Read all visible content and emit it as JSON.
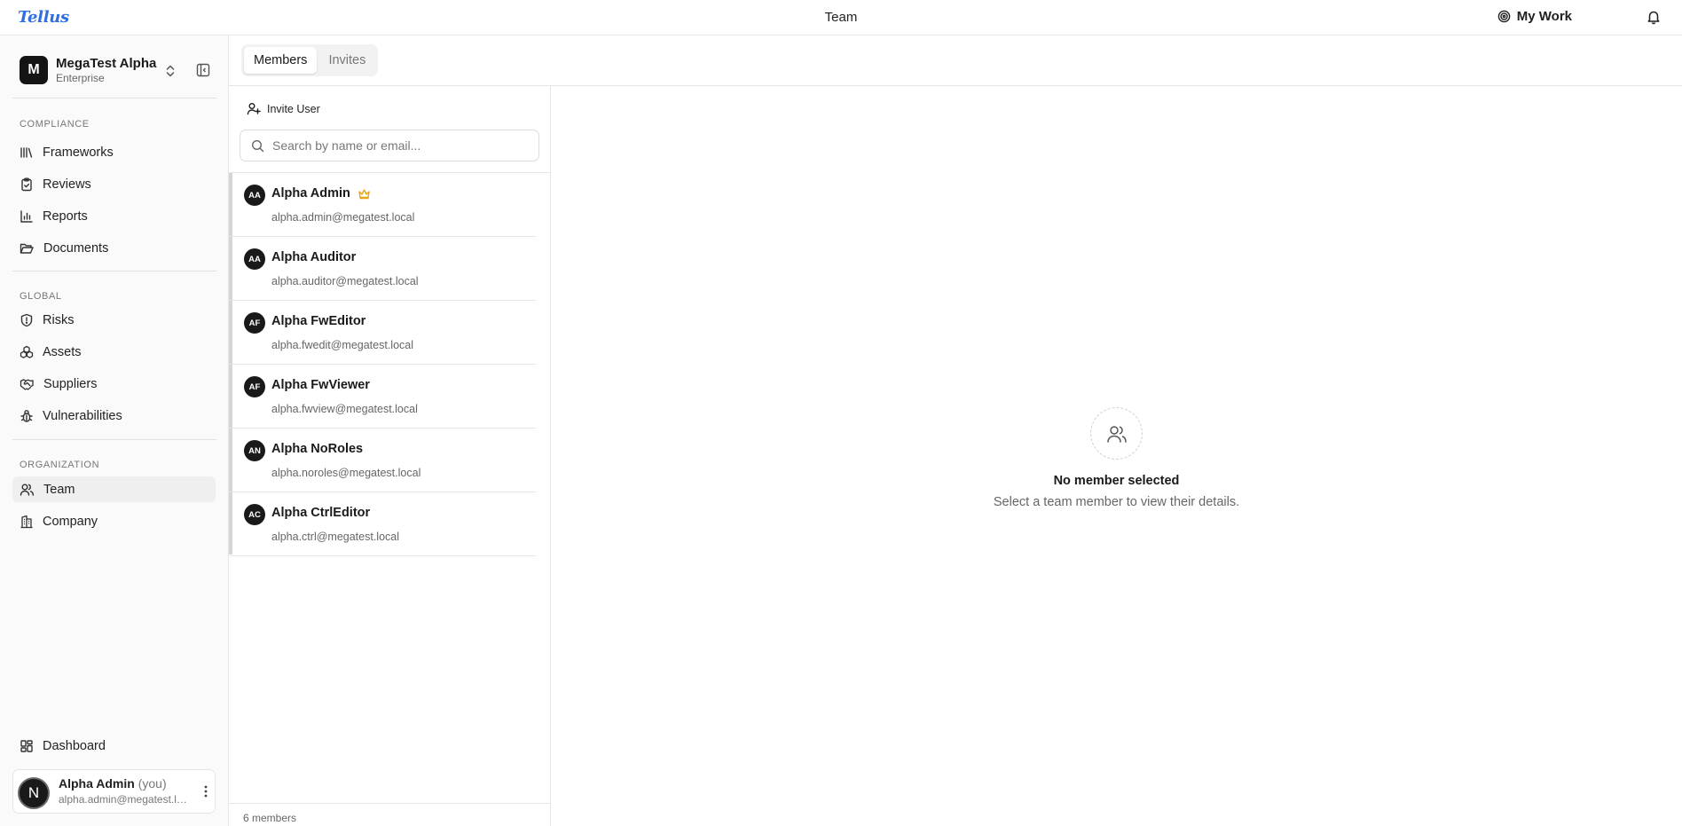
{
  "app": {
    "logo": "Tellus",
    "page_title": "Team"
  },
  "topbar": {
    "my_work_label": "My Work"
  },
  "org": {
    "avatar_letter": "M",
    "name": "MegaTest Alpha",
    "plan": "Enterprise"
  },
  "sidebar": {
    "sections": [
      {
        "label": "Compliance",
        "items": [
          "Frameworks",
          "Reviews",
          "Reports",
          "Documents"
        ]
      },
      {
        "label": "Global",
        "items": [
          "Risks",
          "Assets",
          "Suppliers",
          "Vulnerabilities"
        ]
      },
      {
        "label": "Organization",
        "items": [
          "Team",
          "Company"
        ]
      }
    ],
    "bottom_item": "Dashboard",
    "active_item": "Team"
  },
  "current_user": {
    "avatar_letter": "N",
    "name": "Alpha Admin",
    "you_tag": "(you)",
    "email": "alpha.admin@megatest.local"
  },
  "tabs": [
    {
      "label": "Members",
      "active": true
    },
    {
      "label": "Invites",
      "active": false
    }
  ],
  "members_panel": {
    "invite_label": "Invite User",
    "search_placeholder": "Search by name or email...",
    "members": [
      {
        "initials": "AA",
        "name": "Alpha Admin",
        "email": "alpha.admin@megatest.local",
        "owner": true
      },
      {
        "initials": "AA",
        "name": "Alpha Auditor",
        "email": "alpha.auditor@megatest.local",
        "owner": false
      },
      {
        "initials": "AF",
        "name": "Alpha FwEditor",
        "email": "alpha.fwedit@megatest.local",
        "owner": false
      },
      {
        "initials": "AF",
        "name": "Alpha FwViewer",
        "email": "alpha.fwview@megatest.local",
        "owner": false
      },
      {
        "initials": "AN",
        "name": "Alpha NoRoles",
        "email": "alpha.noroles@megatest.local",
        "owner": false
      },
      {
        "initials": "AC",
        "name": "Alpha CtrlEditor",
        "email": "alpha.ctrl@megatest.local",
        "owner": false
      }
    ],
    "footer_count": "6 members"
  },
  "detail": {
    "empty_title": "No member selected",
    "empty_subtitle": "Select a team member to view their details."
  },
  "colors": {
    "brand": "#2f6fe0",
    "owner_crown": "#e8a317",
    "avatar_bg": "#1a1a1a"
  }
}
